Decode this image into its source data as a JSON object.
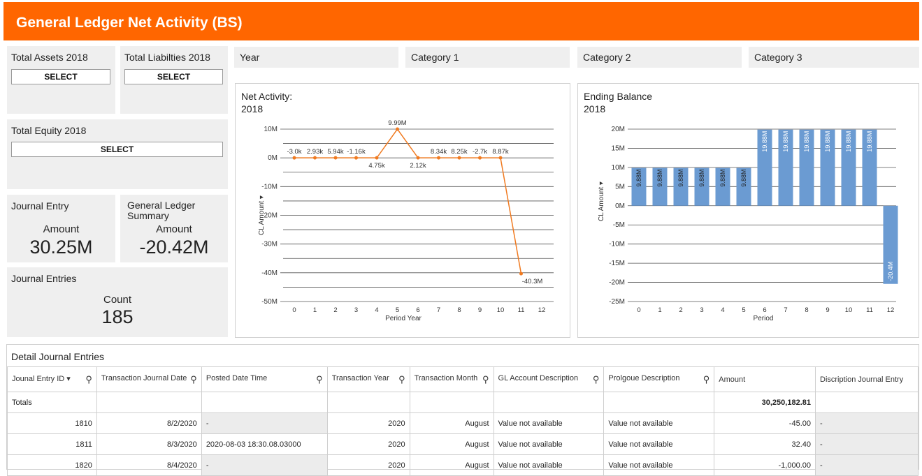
{
  "header": {
    "title": "General Ledger Net Activity (BS)"
  },
  "tiles": {
    "total_assets": {
      "title": "Total Assets 2018",
      "button": "SELECT"
    },
    "total_liabilities": {
      "title": "Total Liabilties 2018",
      "button": "SELECT"
    },
    "total_equity": {
      "title": "Total Equity 2018",
      "button": "SELECT"
    },
    "journal_entry": {
      "title": "Journal Entry",
      "sub": "Amount",
      "value": "30.25M"
    },
    "gl_summary": {
      "title": "General Ledger\nSummary",
      "sub": "Amount",
      "value": "-20.42M"
    },
    "journal_entries": {
      "title": "Journal Entries",
      "sub": "Count",
      "value": "185"
    }
  },
  "filters": {
    "year": "Year",
    "cat1": "Category 1",
    "cat2": "Category 2",
    "cat3": "Category 3"
  },
  "chart_data": [
    {
      "type": "line",
      "title": "Net Activity:",
      "subtitle": "2018",
      "xlabel": "Period Year",
      "ylabel": "CL Amount",
      "x": [
        0,
        1,
        2,
        3,
        4,
        5,
        6,
        7,
        8,
        9,
        10,
        11,
        12
      ],
      "y": [
        -3000,
        2930,
        5940,
        -1160,
        4750,
        9990000,
        2120,
        8340,
        8250,
        -2700,
        8870,
        -40300000,
        null
      ],
      "yticks": [
        "10M",
        "0M",
        "-10M",
        "-20M",
        "-30M",
        "-40M",
        "-50M"
      ],
      "data_labels": [
        "-3.0k",
        "2.93k",
        "5.94k",
        "-1.16k",
        "4.75k",
        "9.99M",
        "2.12k",
        "8.34k",
        "8.25k",
        "-2.7k",
        "8.87k",
        "-40.3M"
      ],
      "ylim": [
        -50000000,
        10000000
      ],
      "color": "#f07a20"
    },
    {
      "type": "bar",
      "title": "Ending Balance",
      "subtitle": "2018",
      "xlabel": "Period",
      "ylabel": "CL Amount",
      "categories": [
        "0",
        "1",
        "2",
        "3",
        "4",
        "5",
        "6",
        "7",
        "8",
        "9",
        "10",
        "11",
        "12"
      ],
      "values": [
        9880000,
        9880000,
        9880000,
        9880000,
        9880000,
        9880000,
        19880000,
        19880000,
        19880000,
        19880000,
        19880000,
        19880000,
        -20400000
      ],
      "data_labels": [
        "9.88M",
        "9.88M",
        "9.88M",
        "9.88M",
        "9.88M",
        "9.88M",
        "19.88M",
        "19.88M",
        "19.88M",
        "19.88M",
        "19.88M",
        "19.88M",
        "-20.4M"
      ],
      "yticks": [
        "20M",
        "15M",
        "10M",
        "5M",
        "0M",
        "-5M",
        "-10M",
        "-15M",
        "-20M",
        "-25M"
      ],
      "ylim": [
        -25000000,
        20000000
      ],
      "color": "#6b9bd2"
    }
  ],
  "table": {
    "title": "Detail Journal Entries",
    "columns": [
      "Jounal Entry ID ▾",
      "Transaction Journal Date",
      "Posted Date Time",
      "Transaction Year",
      "Transaction Month",
      "GL Account Description",
      "Prolgoue Description",
      "Amount",
      "Discription Journal Entry"
    ],
    "totals": {
      "label": "Totals",
      "amount": "30,250,182.81"
    },
    "rows": [
      [
        "1810",
        "8/2/2020",
        "-",
        "2020",
        "August",
        "Value not available",
        "Value not available",
        "-45.00",
        "-"
      ],
      [
        "1811",
        "8/3/2020",
        "2020-08-03 18:30.08.03000",
        "2020",
        "August",
        "Value not available",
        "Value not available",
        "32.40",
        "-"
      ],
      [
        "1820",
        "8/4/2020",
        "-",
        "2020",
        "August",
        "Value not available",
        "Value not available",
        "-1,000.00",
        "-"
      ]
    ]
  }
}
